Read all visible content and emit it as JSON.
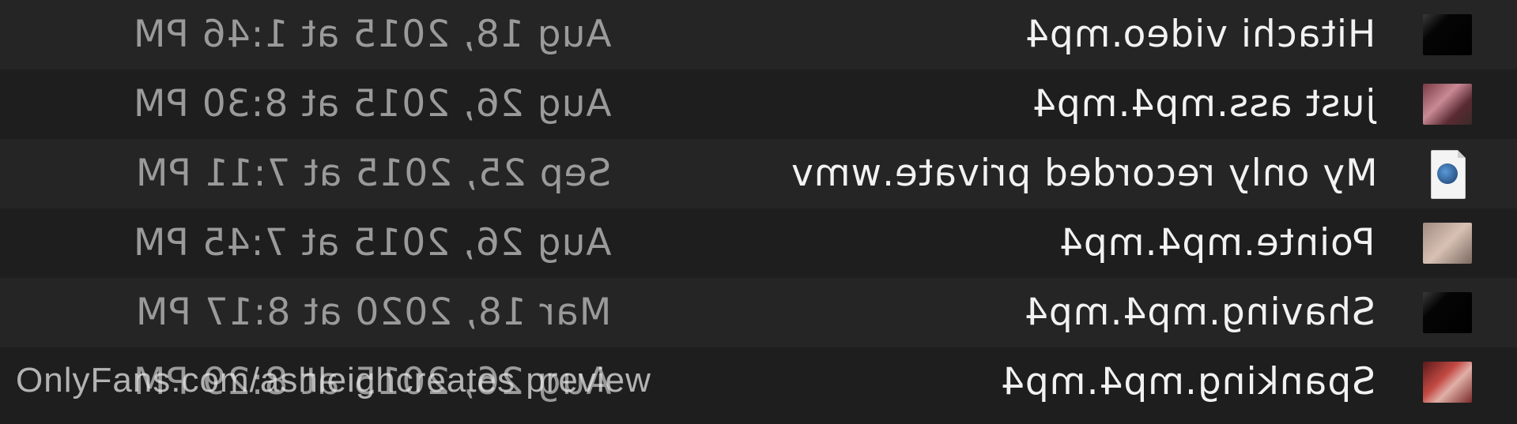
{
  "files": [
    {
      "name": "Hitachi video.mp4",
      "date": "Aug 18, 2015 at 1:46 PM",
      "thumb": "black-thumbnail"
    },
    {
      "name": "just ass.mp4.mp4",
      "date": "Aug 26, 2015 at 8:30 PM",
      "thumb": "pink-thumbnail"
    },
    {
      "name": "My only recorded private.wmv",
      "date": "Sep 25, 2015 at 7:11 PM",
      "thumb": "wmv-document-icon"
    },
    {
      "name": "Pointe.mp4.mp4",
      "date": "Aug 26, 2015 at 7:45 PM",
      "thumb": "skin-thumbnail"
    },
    {
      "name": "Shaving.mp4.mp4",
      "date": "Mar 18, 2020 at 8:17 PM",
      "thumb": "black-thumbnail"
    },
    {
      "name": "Spanking.mp4.mp4",
      "date": "Aug 26, 2015 at 8:29 PM",
      "thumb": "red-thumbnail"
    }
  ],
  "watermark": "OnlyFans.com/ashleighcreates preview",
  "colors": {
    "background": "#232323",
    "row_alt": "#1e1e1e",
    "name_text": "#f2f2f2",
    "date_text": "#9a9a9a"
  }
}
